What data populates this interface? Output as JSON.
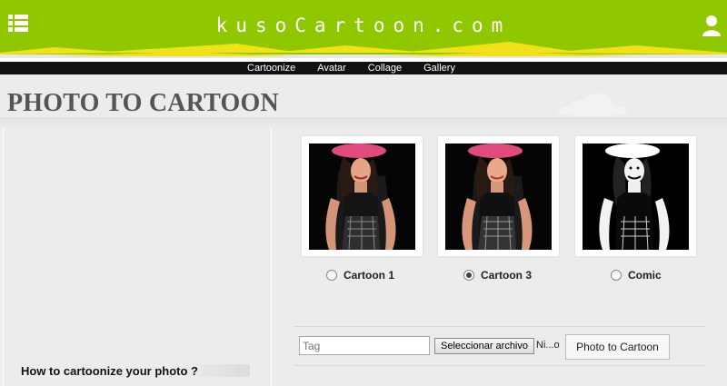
{
  "header": {
    "logo": "kusoCartoon.com",
    "accent_color": "#8fc800",
    "icons": {
      "menu": "list-menu-icon",
      "user": "user-icon"
    }
  },
  "nav": {
    "items": [
      {
        "label": "Cartoonize"
      },
      {
        "label": "Avatar"
      },
      {
        "label": "Collage"
      },
      {
        "label": "Gallery"
      }
    ]
  },
  "page": {
    "title": "PHOTO TO CARTOON"
  },
  "styles": {
    "options": [
      {
        "label": "Cartoon 1",
        "selected": false,
        "look": "color"
      },
      {
        "label": "Cartoon 3",
        "selected": true,
        "look": "color"
      },
      {
        "label": "Comic",
        "selected": false,
        "look": "ink"
      }
    ]
  },
  "form": {
    "tag_placeholder": "Tag",
    "tag_value": "",
    "file_button_label": "Seleccionar archivo",
    "file_status": "Ni...o",
    "submit_label": "Photo to Cartoon"
  },
  "sidebar": {
    "howto_label": "How to cartoonize your photo ?"
  }
}
